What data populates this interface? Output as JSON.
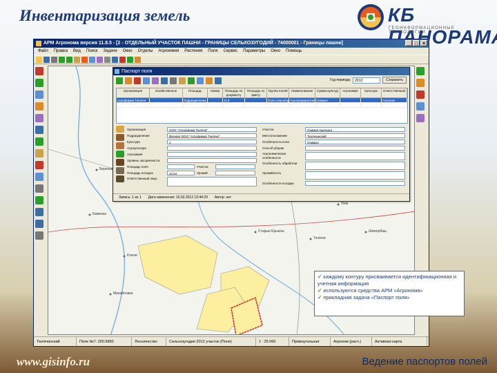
{
  "slide": {
    "title": "Инвентаризация земель",
    "logo_text": "КБ ПАНОРАМА",
    "logo_subtitle": "ГЕОИНФОРМАЦИОННЫЕ ТЕХНОЛОГИИ",
    "site_url": "www.gisinfo.ru",
    "caption": "Ведение паспортов полей"
  },
  "app": {
    "title": "АРМ Агронома версия 11.8.5 - [2 - ОТДЕЛЬНЫЙ УЧАСТОК ПАШНИ - ГРАНИЦЫ СЕЛЬХОЗУГОДИЙ - 74000001 - Границы пашни]",
    "menu": [
      "Файл",
      "Правка",
      "Вид",
      "Поиск",
      "Задачи",
      "Окно",
      "Отделы",
      "Агрохимия",
      "Растения",
      "Поля",
      "Сервис",
      "Параметры",
      "Окно",
      "Помощь"
    ],
    "map_labels": [
      "Березовка",
      "Каменка",
      "Ключи",
      "Тюлячи",
      "Шеморбаш",
      "Михайловка",
      "Узяк",
      "Старые Ерыклы",
      "Байряка",
      "Верх. Меша"
    ],
    "status": [
      "Тюлячинский",
      "Поле №7: 200.5890",
      "Лесничество",
      "Сельхозугодия 2012 участок (Поле)",
      "1 : 25 000",
      "Прямоугольная",
      "Агроном (расч.)",
      "Активная карта"
    ]
  },
  "passport": {
    "title": "Паспорт поля",
    "period_label": "Год периода:",
    "period_value": "2012",
    "apply_button": "Сохранить",
    "grid": {
      "headers": [
        "Организация",
        "Хозяйственное",
        "Площадь",
        "Номер",
        "Площадь по документу",
        "Площадь по факту",
        "Группа полей",
        "Наименование",
        "Сумма культур",
        "Агрохимия",
        "Культура",
        "Ответственный"
      ],
      "rows": [
        [
          "Агрофирма Тюлячи",
          "",
          "Подразделение 1",
          "",
          "11.9",
          "",
          "Поле севооборота",
          "Агропредприятие",
          "Озимые",
          "",
          "",
          "Агроном"
        ],
        [
          "",
          "",
          "",
          "",
          "",
          "",
          "",
          "",
          "",
          "",
          "",
          ""
        ]
      ]
    },
    "form": {
      "labels_left": [
        "Организация",
        "Подразделение",
        "Культура",
        "Агрокультура",
        "Агрохимия",
        "Уровень засоренности",
        "Площадь поля",
        "Площадь посадок",
        "Ответственный лицо"
      ],
      "values_left": [
        "ООО \"Агрофирма Тюлячи\"",
        "Филиал ООО \"Агрофирма Тюлячи\"",
        "1",
        "",
        "",
        "",
        "",
        "",
        ""
      ],
      "extra_label_1": "Участок",
      "extra_label_2": "Урожай",
      "extra_value_2": "34.54",
      "labels_right": [
        "Участок",
        "Местоположение",
        "Особенности поля",
        "Способ уборки",
        "Агрономические особенности",
        "Особенность обработки",
        "Урожайность",
        "Особенности посадки"
      ],
      "values_right": [
        "Озимая пшеница",
        "Тюлячинский",
        "Озимые",
        "",
        "",
        "",
        "",
        ""
      ]
    },
    "statusbar": [
      "Запись: 1 из 1",
      "Дата изменения: 16.02.2012 13:44:29",
      "Автор: нет"
    ]
  },
  "callout": {
    "items": [
      "каждому контуру присваивается идентификационная и учетная информация",
      "используются средства АРМ «Агронома»",
      "прикладная задача «Паспорт поля»"
    ]
  },
  "colors": {
    "title_blue": "#1d3b7a",
    "field_yellow": "#fcefa0",
    "selected_red": "#d61f1f",
    "check_green": "#2a9d2a"
  }
}
